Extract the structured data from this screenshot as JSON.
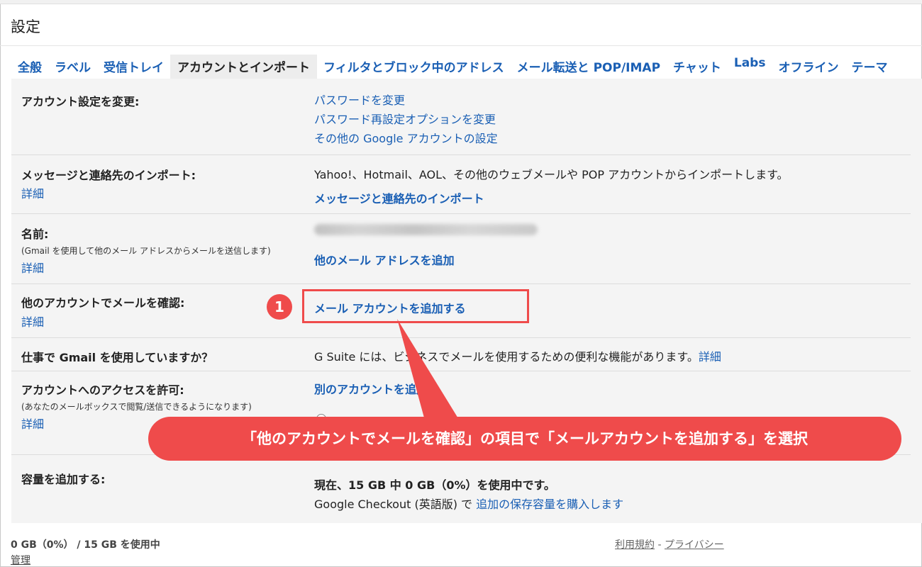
{
  "page_title": "設定",
  "tabs": [
    {
      "label": "全般"
    },
    {
      "label": "ラベル"
    },
    {
      "label": "受信トレイ"
    },
    {
      "label": "アカウントとインポート"
    },
    {
      "label": "フィルタとブロック中のアドレス"
    },
    {
      "label": "メール転送と POP/IMAP"
    },
    {
      "label": "チャット"
    },
    {
      "label": "Labs"
    },
    {
      "label": "オフライン"
    },
    {
      "label": "テーマ"
    }
  ],
  "active_tab_index": 3,
  "rows": {
    "change_account": {
      "label": "アカウント設定を変更:",
      "links": [
        "パスワードを変更",
        "パスワード再設定オプションを変更",
        "その他の Google アカウントの設定"
      ]
    },
    "import": {
      "label": "メッセージと連絡先のインポート:",
      "more": "詳細",
      "description": "Yahoo!、Hotmail、AOL、その他のウェブメールや POP アカウントからインポートします。",
      "action": "メッセージと連絡先のインポート"
    },
    "name": {
      "label": "名前:",
      "sub": "(Gmail を使用して他のメール アドレスからメールを送信します)",
      "more": "詳細",
      "action": "他のメール アドレスを追加"
    },
    "check_mail": {
      "label": "他のアカウントでメールを確認:",
      "more": "詳細",
      "action": "メール アカウントを追加する"
    },
    "work": {
      "label": "仕事で Gmail を使用していますか？",
      "description": "G Suite には、ビジネスでメールを使用するための便利な機能があります。",
      "more": "詳細"
    },
    "grant_access": {
      "label": "アカウントへのアクセスを許可:",
      "sub": "(あなたのメールボックスで閲覧/送信できるようになります)",
      "more": "詳細",
      "action": "別のアカウントを追加"
    },
    "storage": {
      "label": "容量を追加する:",
      "usage": "現在、15 GB 中 0 GB（0%）を使用中です。",
      "checkout_prefix": "Google Checkout (英語版) で ",
      "checkout_link": "追加の保存容量を購入します"
    }
  },
  "footer": {
    "usage": "0 GB（0%） / 15 GB を使用中",
    "manage": "管理",
    "terms": "利用規約",
    "separator": " - ",
    "privacy": "プライバシー"
  },
  "annotation": {
    "step": "1",
    "callout": "「他のアカウントでメールを確認」の項目で「メールアカウントを追加する」を選択",
    "color": "#ef4b4b"
  },
  "colors": {
    "link": "#1a5fb4",
    "panel_bg": "#f4f4f4",
    "active_tab_bg": "#ededed"
  }
}
